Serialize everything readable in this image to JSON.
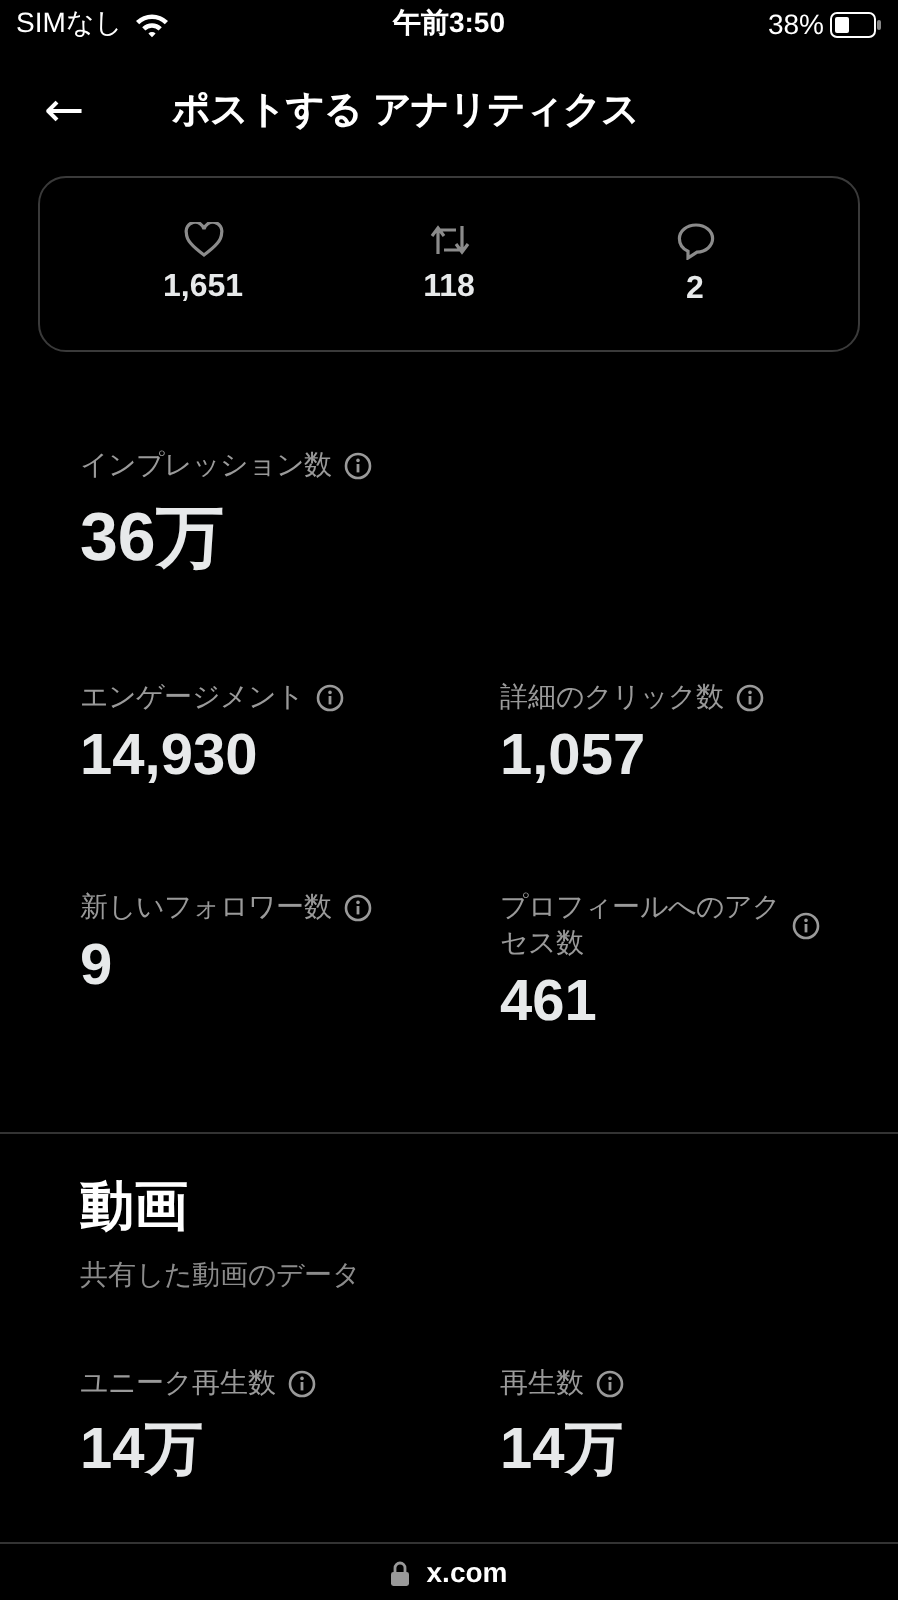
{
  "status_bar": {
    "carrier": "SIMなし",
    "time": "午前3:50",
    "battery": "38%"
  },
  "header": {
    "back": "←",
    "title": "ポストする アナリティクス"
  },
  "engagement_card": [
    {
      "kind": "likes",
      "value": "1,651"
    },
    {
      "kind": "reposts",
      "value": "118"
    },
    {
      "kind": "replies",
      "value": "2"
    }
  ],
  "impressions": {
    "label": "インプレッション数",
    "value": "36万"
  },
  "metrics": [
    {
      "label": "エンゲージメント",
      "value": "14,930"
    },
    {
      "label": "詳細のクリック数",
      "value": "1,057"
    },
    {
      "label": "新しいフォロワー数",
      "value": "9"
    },
    {
      "label": "プロフィールへのアクセス数",
      "value": "461"
    }
  ],
  "video": {
    "title": "動画",
    "subtitle": "共有した動画のデータ",
    "metrics": [
      {
        "label": "ユニーク再生数",
        "value": "14万"
      },
      {
        "label": "再生数",
        "value": "14万"
      }
    ]
  },
  "url_bar": {
    "url": "x.com"
  }
}
